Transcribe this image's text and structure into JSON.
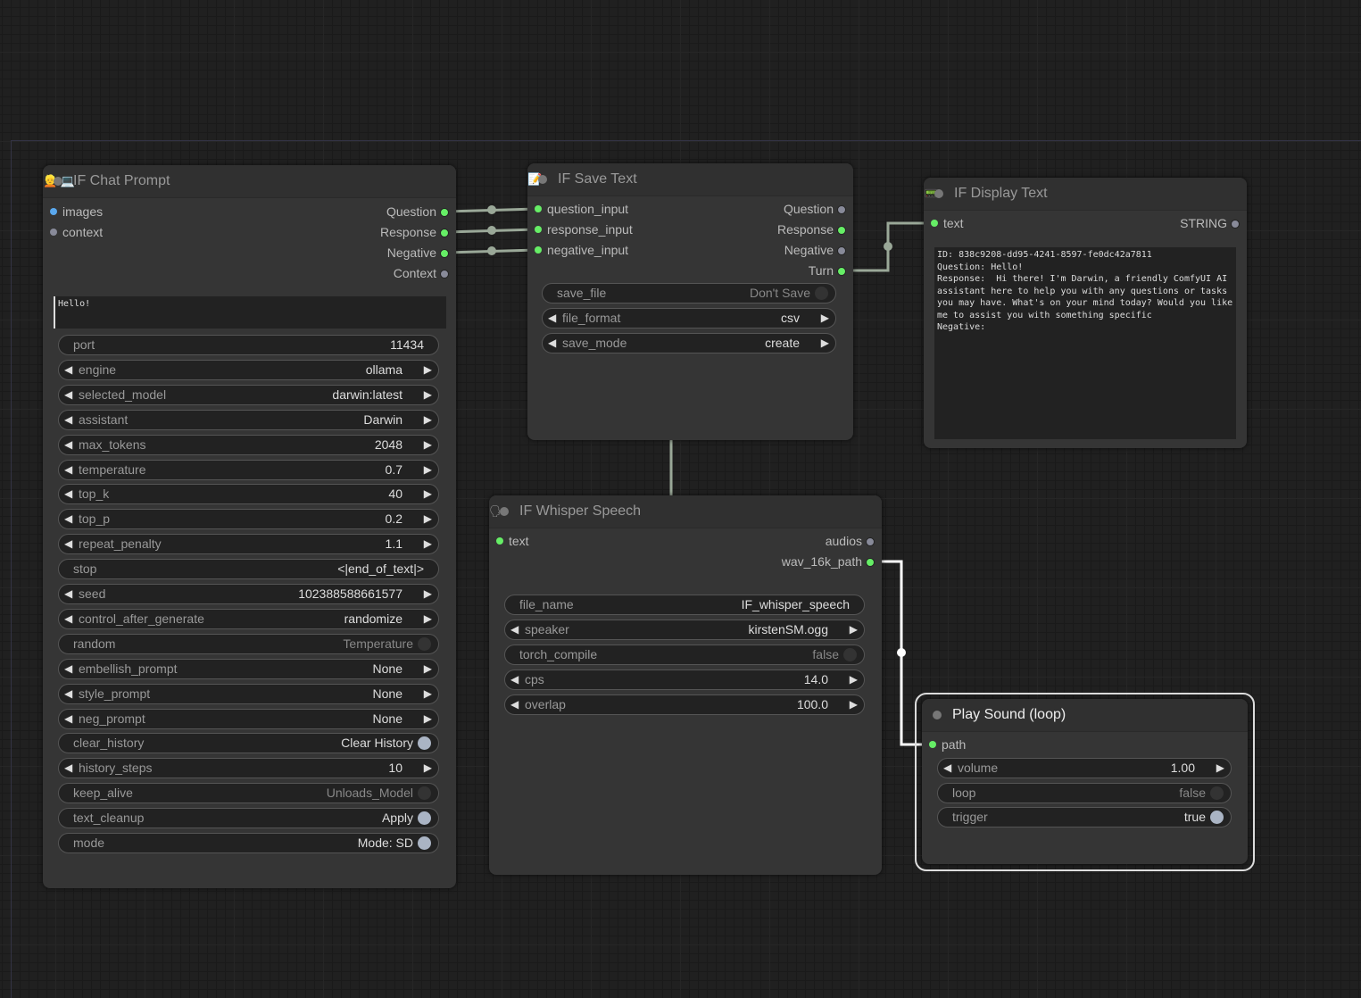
{
  "nodes": {
    "chat": {
      "title": "IF Chat Prompt",
      "icons": [
        "person-emoji-icon",
        "laptop-emoji-icon"
      ],
      "inputs": [
        {
          "label": "images",
          "color": "#5aa8ee"
        },
        {
          "label": "context",
          "color": "#888a99"
        }
      ],
      "outputs": [
        {
          "label": "Question",
          "color": "#6e6"
        },
        {
          "label": "Response",
          "color": "#6e6"
        },
        {
          "label": "Negative",
          "color": "#6e6"
        },
        {
          "label": "Context",
          "color": "#888a99"
        }
      ],
      "prompt_text": "Hello!",
      "widgets": [
        {
          "type": "text",
          "label": "port",
          "value": "11434"
        },
        {
          "type": "combo",
          "label": "engine",
          "value": "ollama"
        },
        {
          "type": "combo",
          "label": "selected_model",
          "value": "darwin:latest"
        },
        {
          "type": "combo",
          "label": "assistant",
          "value": "Darwin"
        },
        {
          "type": "combo",
          "label": "max_tokens",
          "value": "2048"
        },
        {
          "type": "combo",
          "label": "temperature",
          "value": "0.7"
        },
        {
          "type": "combo",
          "label": "top_k",
          "value": "40"
        },
        {
          "type": "combo",
          "label": "top_p",
          "value": "0.2"
        },
        {
          "type": "combo",
          "label": "repeat_penalty",
          "value": "1.1"
        },
        {
          "type": "text",
          "label": "stop",
          "value": "<|end_of_text|>"
        },
        {
          "type": "combo",
          "label": "seed",
          "value": "102388588661577"
        },
        {
          "type": "combo",
          "label": "control_after_generate",
          "value": "randomize"
        },
        {
          "type": "toggle",
          "label": "random",
          "value": "Temperature",
          "on": false
        },
        {
          "type": "combo",
          "label": "embellish_prompt",
          "value": "None"
        },
        {
          "type": "combo",
          "label": "style_prompt",
          "value": "None"
        },
        {
          "type": "combo",
          "label": "neg_prompt",
          "value": "None"
        },
        {
          "type": "toggle",
          "label": "clear_history",
          "value": "Clear History",
          "on": true
        },
        {
          "type": "combo",
          "label": "history_steps",
          "value": "10"
        },
        {
          "type": "toggle",
          "label": "keep_alive",
          "value": "Unloads_Model",
          "on": false
        },
        {
          "type": "toggle",
          "label": "text_cleanup",
          "value": "Apply",
          "on": true
        },
        {
          "type": "toggle",
          "label": "mode",
          "value": "Mode: SD",
          "on": true
        }
      ]
    },
    "save": {
      "title": "IF Save Text",
      "icons": [
        "memo-emoji-icon"
      ],
      "inputs": [
        {
          "label": "question_input",
          "color": "#6e6"
        },
        {
          "label": "response_input",
          "color": "#6e6"
        },
        {
          "label": "negative_input",
          "color": "#6e6"
        }
      ],
      "outputs": [
        {
          "label": "Question",
          "color": "#888a99"
        },
        {
          "label": "Response",
          "color": "#6e6"
        },
        {
          "label": "Negative",
          "color": "#888a99"
        },
        {
          "label": "Turn",
          "color": "#6e6"
        }
      ],
      "widgets": [
        {
          "type": "toggle",
          "label": "save_file",
          "value": "Don't Save",
          "on": false
        },
        {
          "type": "combo",
          "label": "file_format",
          "value": "csv"
        },
        {
          "type": "combo",
          "label": "save_mode",
          "value": "create"
        }
      ]
    },
    "display": {
      "title": "IF Display Text",
      "icons": [
        "monitor-emoji-icon"
      ],
      "inputs": [
        {
          "label": "text",
          "color": "#6e6"
        }
      ],
      "outputs": [
        {
          "label": "STRING",
          "color": "#888a99"
        }
      ],
      "text": "ID: 838c9208-dd95-4241-8597-fe0dc42a7811\nQuestion: Hello!\nResponse:  Hi there! I'm Darwin, a friendly ComfyUI AI assistant here to help you with any questions or tasks you may have. What's on your mind today? Would you like me to assist you with something specific\nNegative:"
    },
    "whisper": {
      "title": "IF Whisper Speech",
      "icons": [
        "speech-emoji-icon"
      ],
      "inputs": [
        {
          "label": "text",
          "color": "#6e6"
        }
      ],
      "outputs": [
        {
          "label": "audios",
          "color": "#888a99"
        },
        {
          "label": "wav_16k_path",
          "color": "#6e6"
        }
      ],
      "widgets": [
        {
          "type": "text",
          "label": "file_name",
          "value": "IF_whisper_speech"
        },
        {
          "type": "combo",
          "label": "speaker",
          "value": "kirstenSM.ogg"
        },
        {
          "type": "toggle",
          "label": "torch_compile",
          "value": "false",
          "on": false
        },
        {
          "type": "combo",
          "label": "cps",
          "value": "14.0"
        },
        {
          "type": "combo",
          "label": "overlap",
          "value": "100.0"
        }
      ]
    },
    "play": {
      "title": "Play Sound (loop)",
      "icons": [],
      "inputs": [
        {
          "label": "path",
          "color": "#6e6"
        }
      ],
      "outputs": [],
      "widgets": [
        {
          "type": "combo",
          "label": "volume",
          "value": "1.00"
        },
        {
          "type": "toggle",
          "label": "loop",
          "value": "false",
          "on": false
        },
        {
          "type": "toggle",
          "label": "trigger",
          "value": "true",
          "on": true
        }
      ]
    }
  }
}
